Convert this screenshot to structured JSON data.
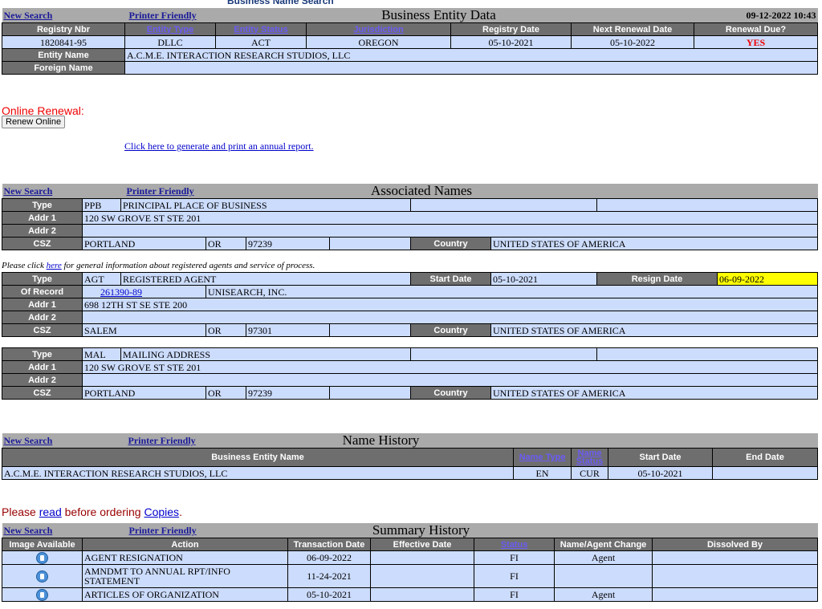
{
  "banner": "Business Name Search",
  "links": {
    "new_search": "New Search",
    "printer_friendly": "Printer Friendly"
  },
  "entity": {
    "title": "Business Entity Data",
    "datetime": "09-12-2022 10:43",
    "headers": {
      "registry_nbr": "Registry Nbr",
      "entity_type": "Entity Type",
      "entity_status": "Entity Status",
      "jurisdiction": "Jurisdiction",
      "registry_date": "Registry Date",
      "next_renewal": "Next Renewal Date",
      "renewal_due": "Renewal Due?"
    },
    "values": {
      "registry_nbr": "1820841-95",
      "entity_type": "DLLC",
      "entity_status": "ACT",
      "jurisdiction": "OREGON",
      "registry_date": "05-10-2021",
      "next_renewal": "05-10-2022",
      "renewal_due": "YES"
    },
    "name_label": "Entity Name",
    "name_value": "A.C.M.E. INTERACTION RESEARCH STUDIOS, LLC",
    "foreign_label": "Foreign Name",
    "foreign_value": ""
  },
  "renewal": {
    "label": "Online Renewal:",
    "button": "Renew Online",
    "annual_link": "Click here to generate and print an annual report."
  },
  "associated": {
    "title": "Associated Names",
    "labels": {
      "type": "Type",
      "addr1": "Addr 1",
      "addr2": "Addr 2",
      "csz": "CSZ",
      "country": "Country",
      "of_record": "Of Record",
      "start_date": "Start Date",
      "resign_date": "Resign Date"
    },
    "ppb": {
      "code": "PPB",
      "desc": "PRINCIPAL PLACE OF BUSINESS",
      "addr1": "120 SW GROVE ST STE 201",
      "addr2": "",
      "city": "PORTLAND",
      "state": "OR",
      "zip": "97239",
      "country": "UNITED STATES OF AMERICA"
    },
    "agent_note_pre": "Please click ",
    "agent_note_link": "here",
    "agent_note_post": " for general information about registered agents and service of process.",
    "agt": {
      "code": "AGT",
      "desc": "REGISTERED AGENT",
      "start": "05-10-2021",
      "resign": "06-09-2022",
      "record_nbr": "261390-89",
      "record_name": "UNISEARCH, INC.",
      "addr1": "698 12TH ST SE STE 200",
      "addr2": "",
      "city": "SALEM",
      "state": "OR",
      "zip": "97301",
      "country": "UNITED STATES OF AMERICA"
    },
    "mal": {
      "code": "MAL",
      "desc": "MAILING ADDRESS",
      "addr1": "120 SW GROVE ST STE 201",
      "addr2": "",
      "city": "PORTLAND",
      "state": "OR",
      "zip": "97239",
      "country": "UNITED STATES OF AMERICA"
    }
  },
  "name_history": {
    "title": "Name History",
    "headers": {
      "name": "Business Entity Name",
      "name_type": "Name Type",
      "name_status": "Name Status",
      "start": "Start Date",
      "end": "End Date"
    },
    "row": {
      "name": "A.C.M.E. INTERACTION RESEARCH STUDIOS, LLC",
      "type": "EN",
      "status": "CUR",
      "start": "05-10-2021",
      "end": ""
    }
  },
  "copies": {
    "pre": "Please ",
    "read": "read",
    "mid": " before ordering ",
    "copies": "Copies",
    "post": "."
  },
  "summary": {
    "title": "Summary History",
    "headers": {
      "image": "Image Available",
      "action": "Action",
      "trans_date": "Transaction Date",
      "eff_date": "Effective Date",
      "status": "Status",
      "change": "Name/Agent Change",
      "dissolved": "Dissolved By"
    },
    "rows": [
      {
        "action": "AGENT RESIGNATION",
        "trans": "06-09-2022",
        "eff": "",
        "status": "FI",
        "change": "Agent",
        "dissolved": ""
      },
      {
        "action": "AMNDMT TO ANNUAL RPT/INFO STATEMENT",
        "trans": "11-24-2021",
        "eff": "",
        "status": "FI",
        "change": "",
        "dissolved": ""
      },
      {
        "action": "ARTICLES OF ORGANIZATION",
        "trans": "05-10-2021",
        "eff": "",
        "status": "FI",
        "change": "Agent",
        "dissolved": ""
      }
    ]
  }
}
